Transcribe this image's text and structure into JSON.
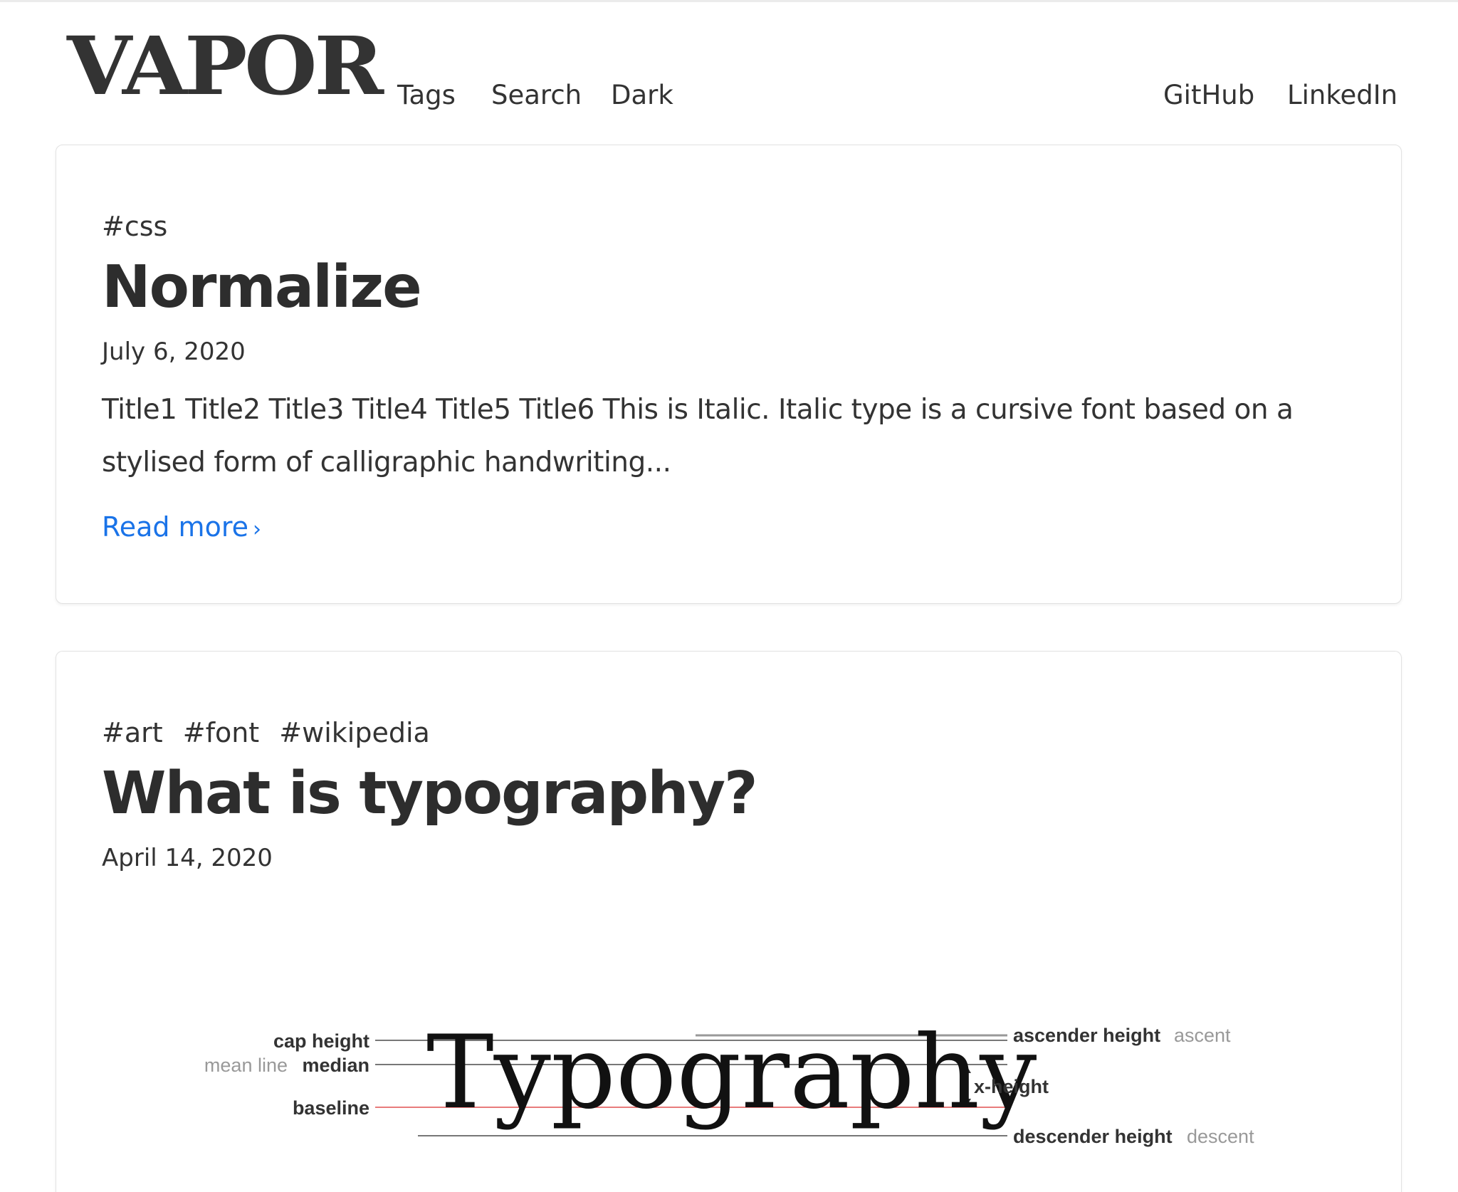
{
  "header": {
    "logo": "VAPOR",
    "nav_left": [
      "Tags",
      "Search",
      "Dark"
    ],
    "nav_right": [
      "GitHub",
      "LinkedIn"
    ]
  },
  "posts": [
    {
      "tags": [
        "#css"
      ],
      "title": "Normalize",
      "date": "July 6, 2020",
      "excerpt": "Title1 Title2 Title3 Title4 Title5 Title6 This is Italic. Italic type is a cursive font based on a stylised form of calligraphic handwriting...",
      "read_more": "Read more",
      "read_more_icon": "chevron-right-icon"
    },
    {
      "tags": [
        "#art",
        "#font",
        "#wikipedia"
      ],
      "title": "What is typography?",
      "date": "April 14, 2020",
      "figure": {
        "word": "Typography",
        "labels": {
          "cap_height": "cap height",
          "mean_line": "mean line",
          "median": "median",
          "baseline": "baseline",
          "ascender_height": "ascender height",
          "ascent": "ascent",
          "x_height": "x-height",
          "descender_height": "descender height",
          "descent": "descent"
        }
      }
    }
  ],
  "colors": {
    "text": "#333333",
    "link": "#1a73e8",
    "card_border": "#e2e2e2",
    "baseline_red": "#e05050"
  }
}
